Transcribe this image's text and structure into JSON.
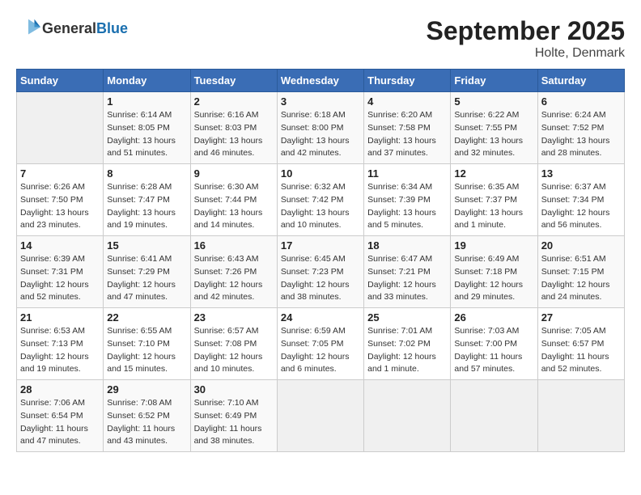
{
  "logo": {
    "general": "General",
    "blue": "Blue"
  },
  "title": "September 2025",
  "subtitle": "Holte, Denmark",
  "weekdays": [
    "Sunday",
    "Monday",
    "Tuesday",
    "Wednesday",
    "Thursday",
    "Friday",
    "Saturday"
  ],
  "weeks": [
    [
      {
        "day": "",
        "info": ""
      },
      {
        "day": "1",
        "info": "Sunrise: 6:14 AM\nSunset: 8:05 PM\nDaylight: 13 hours\nand 51 minutes."
      },
      {
        "day": "2",
        "info": "Sunrise: 6:16 AM\nSunset: 8:03 PM\nDaylight: 13 hours\nand 46 minutes."
      },
      {
        "day": "3",
        "info": "Sunrise: 6:18 AM\nSunset: 8:00 PM\nDaylight: 13 hours\nand 42 minutes."
      },
      {
        "day": "4",
        "info": "Sunrise: 6:20 AM\nSunset: 7:58 PM\nDaylight: 13 hours\nand 37 minutes."
      },
      {
        "day": "5",
        "info": "Sunrise: 6:22 AM\nSunset: 7:55 PM\nDaylight: 13 hours\nand 32 minutes."
      },
      {
        "day": "6",
        "info": "Sunrise: 6:24 AM\nSunset: 7:52 PM\nDaylight: 13 hours\nand 28 minutes."
      }
    ],
    [
      {
        "day": "7",
        "info": "Sunrise: 6:26 AM\nSunset: 7:50 PM\nDaylight: 13 hours\nand 23 minutes."
      },
      {
        "day": "8",
        "info": "Sunrise: 6:28 AM\nSunset: 7:47 PM\nDaylight: 13 hours\nand 19 minutes."
      },
      {
        "day": "9",
        "info": "Sunrise: 6:30 AM\nSunset: 7:44 PM\nDaylight: 13 hours\nand 14 minutes."
      },
      {
        "day": "10",
        "info": "Sunrise: 6:32 AM\nSunset: 7:42 PM\nDaylight: 13 hours\nand 10 minutes."
      },
      {
        "day": "11",
        "info": "Sunrise: 6:34 AM\nSunset: 7:39 PM\nDaylight: 13 hours\nand 5 minutes."
      },
      {
        "day": "12",
        "info": "Sunrise: 6:35 AM\nSunset: 7:37 PM\nDaylight: 13 hours\nand 1 minute."
      },
      {
        "day": "13",
        "info": "Sunrise: 6:37 AM\nSunset: 7:34 PM\nDaylight: 12 hours\nand 56 minutes."
      }
    ],
    [
      {
        "day": "14",
        "info": "Sunrise: 6:39 AM\nSunset: 7:31 PM\nDaylight: 12 hours\nand 52 minutes."
      },
      {
        "day": "15",
        "info": "Sunrise: 6:41 AM\nSunset: 7:29 PM\nDaylight: 12 hours\nand 47 minutes."
      },
      {
        "day": "16",
        "info": "Sunrise: 6:43 AM\nSunset: 7:26 PM\nDaylight: 12 hours\nand 42 minutes."
      },
      {
        "day": "17",
        "info": "Sunrise: 6:45 AM\nSunset: 7:23 PM\nDaylight: 12 hours\nand 38 minutes."
      },
      {
        "day": "18",
        "info": "Sunrise: 6:47 AM\nSunset: 7:21 PM\nDaylight: 12 hours\nand 33 minutes."
      },
      {
        "day": "19",
        "info": "Sunrise: 6:49 AM\nSunset: 7:18 PM\nDaylight: 12 hours\nand 29 minutes."
      },
      {
        "day": "20",
        "info": "Sunrise: 6:51 AM\nSunset: 7:15 PM\nDaylight: 12 hours\nand 24 minutes."
      }
    ],
    [
      {
        "day": "21",
        "info": "Sunrise: 6:53 AM\nSunset: 7:13 PM\nDaylight: 12 hours\nand 19 minutes."
      },
      {
        "day": "22",
        "info": "Sunrise: 6:55 AM\nSunset: 7:10 PM\nDaylight: 12 hours\nand 15 minutes."
      },
      {
        "day": "23",
        "info": "Sunrise: 6:57 AM\nSunset: 7:08 PM\nDaylight: 12 hours\nand 10 minutes."
      },
      {
        "day": "24",
        "info": "Sunrise: 6:59 AM\nSunset: 7:05 PM\nDaylight: 12 hours\nand 6 minutes."
      },
      {
        "day": "25",
        "info": "Sunrise: 7:01 AM\nSunset: 7:02 PM\nDaylight: 12 hours\nand 1 minute."
      },
      {
        "day": "26",
        "info": "Sunrise: 7:03 AM\nSunset: 7:00 PM\nDaylight: 11 hours\nand 57 minutes."
      },
      {
        "day": "27",
        "info": "Sunrise: 7:05 AM\nSunset: 6:57 PM\nDaylight: 11 hours\nand 52 minutes."
      }
    ],
    [
      {
        "day": "28",
        "info": "Sunrise: 7:06 AM\nSunset: 6:54 PM\nDaylight: 11 hours\nand 47 minutes."
      },
      {
        "day": "29",
        "info": "Sunrise: 7:08 AM\nSunset: 6:52 PM\nDaylight: 11 hours\nand 43 minutes."
      },
      {
        "day": "30",
        "info": "Sunrise: 7:10 AM\nSunset: 6:49 PM\nDaylight: 11 hours\nand 38 minutes."
      },
      {
        "day": "",
        "info": ""
      },
      {
        "day": "",
        "info": ""
      },
      {
        "day": "",
        "info": ""
      },
      {
        "day": "",
        "info": ""
      }
    ]
  ]
}
